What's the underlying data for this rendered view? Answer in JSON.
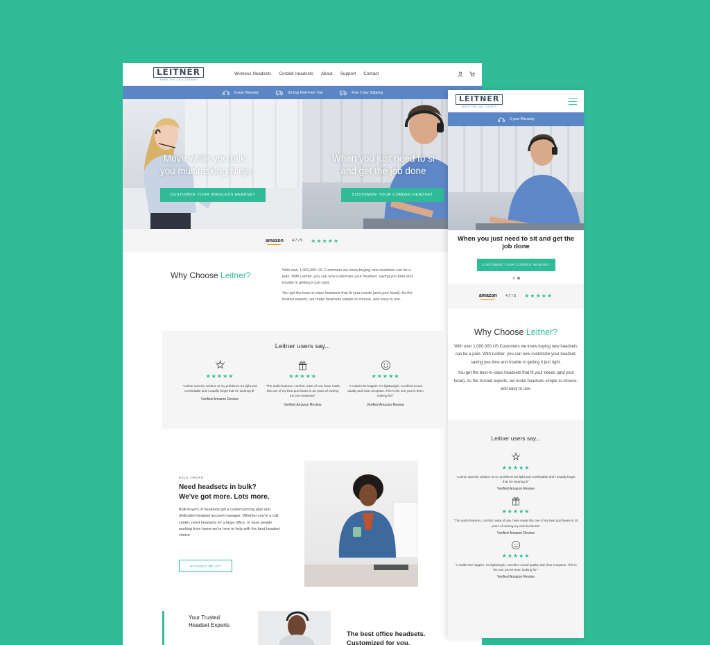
{
  "brand": {
    "logo": "LEITNER",
    "logo_small": "HEADSETS",
    "tagline": "WHEN THE CALL COUNTS"
  },
  "nav": {
    "items": [
      "Wireless Headsets",
      "Corded Headsets",
      "About",
      "Support",
      "Contact"
    ],
    "account_icon": "user-icon",
    "cart_icon": "cart-icon"
  },
  "promo_bar": {
    "items": [
      {
        "icon": "headset-icon",
        "label": "5-year Warranty"
      },
      {
        "icon": "truck-icon",
        "label": "60-Day Risk-Free Trial"
      },
      {
        "icon": "truck-icon",
        "label": "Free 2-day Shipping"
      }
    ]
  },
  "hero": {
    "left": {
      "line1": "Move while you talk,",
      "line2": "you multitasking Ninja",
      "cta": "CUSTOMIZE YOUR WIRELESS HEADSET"
    },
    "right": {
      "line1": "When you just need to si",
      "line2": "and get the job done",
      "cta": "CUSTOMIZE YOUR CORDED HEADSET"
    }
  },
  "rating": {
    "source": "amazon",
    "score": "4.7 / 5",
    "stars": "★★★★★",
    "value": 4.7
  },
  "why": {
    "title_prefix": "Why Choose",
    "title_accent": "Leitner?",
    "p1": "With over 1,000,000 US Customers we know buying new headsets can be a pain. With Leitner, you can now customize your headset, saving you time and trouble in getting it just right.",
    "p2": "You get the best-in-class headsets that fit your needs (and your head). As the trusted experts, we make headsets simple to choose, and easy to use."
  },
  "users_say": {
    "title": "Leitner users say...",
    "reviews": [
      {
        "icon": "sparkle-icon",
        "stars": "★★★★★",
        "text": "\"Leitner was the solution to my problems! It's light and comfortable and I usually forget that I'm wearing it!\"",
        "source": "Verified Amazon Review"
      },
      {
        "icon": "gift-icon",
        "stars": "★★★★★",
        "text": "\"The audio features, comfort, ease of use, have made this one of my best purchases in 25 years of owning my own business!\"",
        "source": "Verified Amazon Review"
      },
      {
        "icon": "smiley-icon",
        "stars": "★★★★★",
        "text": "\"I couldn't be happier. It's lightweight, excellent sound quality and clear reception. This is the one you've been looking for!\"",
        "source": "Verified Amazon Review"
      }
    ]
  },
  "bulk": {
    "tag": "BULK ORDER",
    "title_line1": "Need headsets in bulk?",
    "title_line2": "We've got more. Lots more.",
    "text": "Bulk buyers of headsets get a custom pricing plan and dedicated headset account manager. Whether you're a call center, need headsets for a large office, or have people working from home we're here to help with the best headset choice.",
    "button": "HEADSET ME UP!"
  },
  "trusted": {
    "line1": "Your Trusted",
    "line2": "Headset Experts"
  },
  "best": {
    "line1": "The best office headsets.",
    "line2": "Customized for you."
  },
  "mobile": {
    "promo": "5-year Warranty",
    "hero_title": "When you just need to sit and get the job done",
    "cta": "CUSTOMIZE YOUR CORDED HEADSET",
    "why_p1": "With over 1,000,000 US Customers we know buying new headsets can be a pain. With Leitner, you can now customize your headset, saving you time and trouble in getting it just right.",
    "why_p2": "You get the best-in-class headsets that fit your needs (and your head). As the trusted experts, we make headsets simple to choose, and easy to use."
  },
  "colors": {
    "background": "#2fbb97",
    "accent": "#2fbb97",
    "promo_bar": "#5b86c5"
  }
}
